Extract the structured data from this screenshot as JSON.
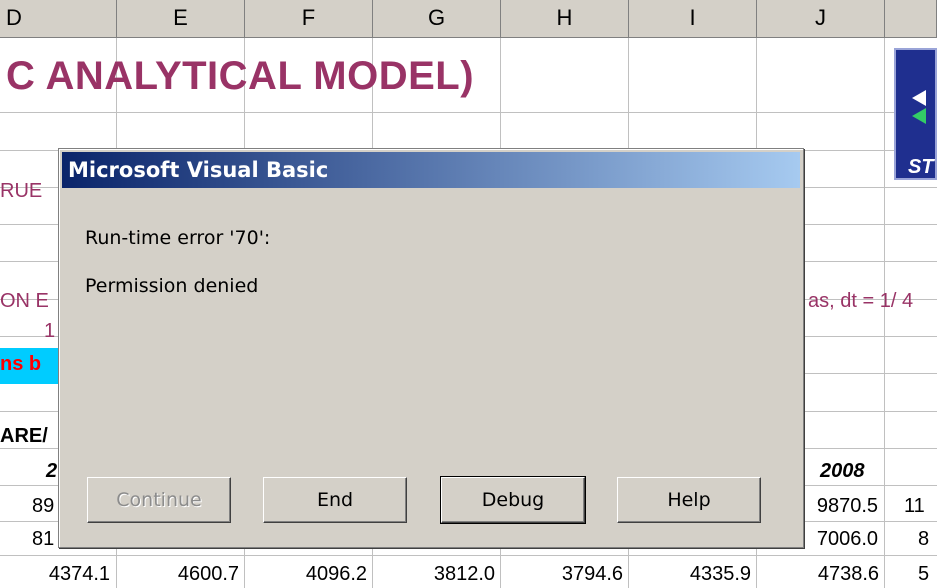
{
  "columns": [
    "D",
    "E",
    "F",
    "G",
    "H",
    "I",
    "J",
    ""
  ],
  "sheet": {
    "title": "C ANALYTICAL MODEL)",
    "row_true": "RUE",
    "row_on_e": "ON E",
    "row_formula": "as,  dt = 1/ 4",
    "row_one": "1",
    "row_ns_b": "ns b",
    "row_area": "ARE/",
    "row_2": "2",
    "year_2008": "2008",
    "nav_label": "ST",
    "row1": {
      "d": "89",
      "j": "9870.5",
      "k": "11"
    },
    "row2": {
      "d": "81",
      "j": "7006.0",
      "k": "8"
    },
    "row3": {
      "d": "4374.1",
      "e": "4600.7",
      "f": "4096.2",
      "g": "3812.0",
      "h": "3794.6",
      "i": "4335.9",
      "j": "4738.6",
      "k": "5"
    }
  },
  "dialog": {
    "title": "Microsoft Visual Basic",
    "error_line": "Run-time error '70':",
    "message": "Permission denied",
    "buttons": {
      "continue": "Continue",
      "end": "End",
      "debug": "Debug",
      "help": "Help"
    }
  },
  "colors": {
    "title": "#993366",
    "header_bg": "#d4d0c8",
    "titlebar_start": "#0a246a",
    "titlebar_end": "#a6caf0",
    "cyan_fill": "#00ccff",
    "nav_bg": "#1f2f8f"
  }
}
